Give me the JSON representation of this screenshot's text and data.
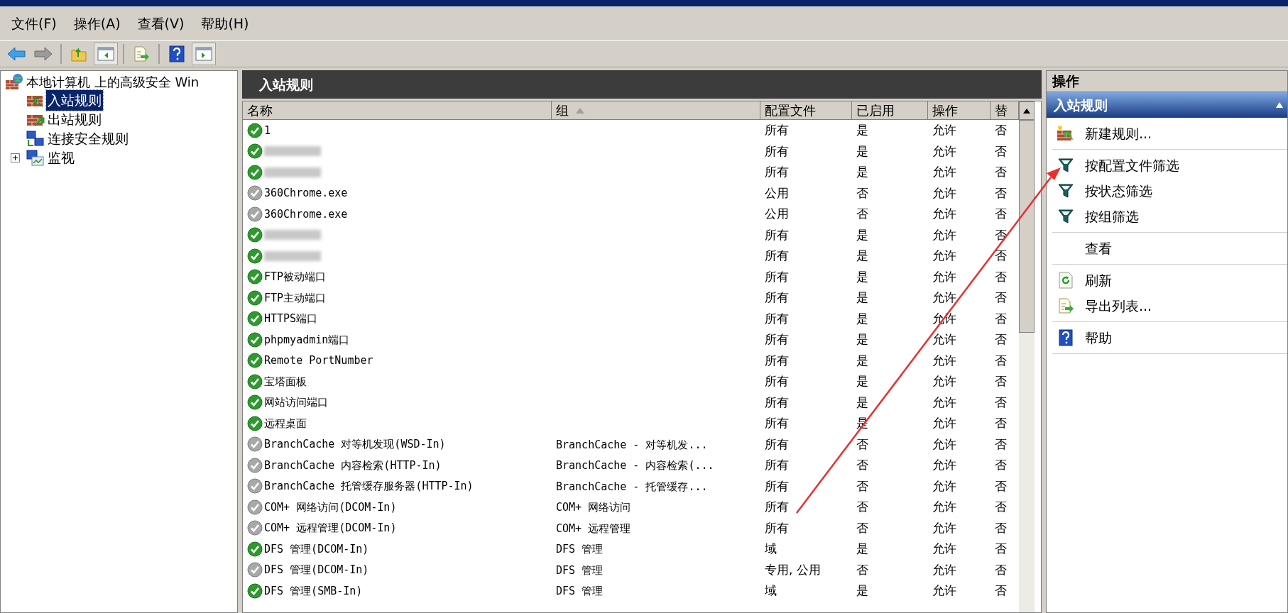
{
  "menu": [
    "文件(F)",
    "操作(A)",
    "查看(V)",
    "帮助(H)"
  ],
  "toolbar": [
    {
      "kind": "back"
    },
    {
      "kind": "forward"
    },
    {
      "kind": "sep"
    },
    {
      "kind": "up"
    },
    {
      "kind": "pane-left",
      "selected": true
    },
    {
      "kind": "sep"
    },
    {
      "kind": "export"
    },
    {
      "kind": "sep"
    },
    {
      "kind": "help"
    },
    {
      "kind": "pane-right",
      "selected": true
    }
  ],
  "tree": {
    "label": "本地计算机 上的高级安全 Win",
    "children": [
      {
        "label": "入站规则",
        "kind": "inbound",
        "selected": true
      },
      {
        "label": "出站规则",
        "kind": "outbound",
        "selected": false
      },
      {
        "label": "连接安全规则",
        "kind": "connection",
        "selected": false
      },
      {
        "label": "监视",
        "kind": "monitor",
        "selected": false,
        "expanded": false
      }
    ]
  },
  "center": {
    "title": "入站规则",
    "columns": [
      {
        "label": "名称"
      },
      {
        "label": "组",
        "sorted": true
      },
      {
        "label": "配置文件"
      },
      {
        "label": "已启用"
      },
      {
        "label": "操作"
      },
      {
        "label": "替"
      }
    ],
    "rows": [
      {
        "enabled": true,
        "name": "1",
        "profile": "所有",
        "enabled_text": "是",
        "action": "允许",
        "override": "否"
      },
      {
        "enabled": true,
        "redacted": true,
        "profile": "所有",
        "enabled_text": "是",
        "action": "允许",
        "override": "否"
      },
      {
        "enabled": true,
        "redacted": true,
        "profile": "所有",
        "enabled_text": "是",
        "action": "允许",
        "override": "否"
      },
      {
        "enabled": false,
        "name": "360Chrome.exe",
        "profile": "公用",
        "enabled_text": "否",
        "action": "允许",
        "override": "否"
      },
      {
        "enabled": false,
        "name": "360Chrome.exe",
        "profile": "公用",
        "enabled_text": "否",
        "action": "允许",
        "override": "否"
      },
      {
        "enabled": true,
        "redacted": true,
        "profile": "所有",
        "enabled_text": "是",
        "action": "允许",
        "override": "否"
      },
      {
        "enabled": true,
        "redacted": true,
        "profile": "所有",
        "enabled_text": "是",
        "action": "允许",
        "override": "否"
      },
      {
        "enabled": true,
        "name": "FTP被动端口",
        "profile": "所有",
        "enabled_text": "是",
        "action": "允许",
        "override": "否"
      },
      {
        "enabled": true,
        "name": "FTP主动端口",
        "profile": "所有",
        "enabled_text": "是",
        "action": "允许",
        "override": "否"
      },
      {
        "enabled": true,
        "name": "HTTPS端口",
        "profile": "所有",
        "enabled_text": "是",
        "action": "允许",
        "override": "否"
      },
      {
        "enabled": true,
        "name": "phpmyadmin端口",
        "profile": "所有",
        "enabled_text": "是",
        "action": "允许",
        "override": "否"
      },
      {
        "enabled": true,
        "name": "Remote PortNumber",
        "profile": "所有",
        "enabled_text": "是",
        "action": "允许",
        "override": "否"
      },
      {
        "enabled": true,
        "name": "宝塔面板",
        "profile": "所有",
        "enabled_text": "是",
        "action": "允许",
        "override": "否"
      },
      {
        "enabled": true,
        "name": "网站访问端口",
        "profile": "所有",
        "enabled_text": "是",
        "action": "允许",
        "override": "否"
      },
      {
        "enabled": true,
        "name": "远程桌面",
        "profile": "所有",
        "enabled_text": "是",
        "action": "允许",
        "override": "否"
      },
      {
        "enabled": false,
        "name": "BranchCache 对等机发现(WSD-In)",
        "group": "BranchCache - 对等机发...",
        "profile": "所有",
        "enabled_text": "否",
        "action": "允许",
        "override": "否"
      },
      {
        "enabled": false,
        "name": "BranchCache 内容检索(HTTP-In)",
        "group": "BranchCache - 内容检索(...",
        "profile": "所有",
        "enabled_text": "否",
        "action": "允许",
        "override": "否"
      },
      {
        "enabled": false,
        "name": "BranchCache 托管缓存服务器(HTTP-In)",
        "group": "BranchCache - 托管缓存...",
        "profile": "所有",
        "enabled_text": "否",
        "action": "允许",
        "override": "否"
      },
      {
        "enabled": false,
        "name": "COM+ 网络访问(DCOM-In)",
        "group": "COM+ 网络访问",
        "profile": "所有",
        "enabled_text": "否",
        "action": "允许",
        "override": "否"
      },
      {
        "enabled": false,
        "name": "COM+ 远程管理(DCOM-In)",
        "group": "COM+ 远程管理",
        "profile": "所有",
        "enabled_text": "否",
        "action": "允许",
        "override": "否"
      },
      {
        "enabled": true,
        "name": "DFS 管理(DCOM-In)",
        "group": "DFS 管理",
        "profile": "域",
        "enabled_text": "是",
        "action": "允许",
        "override": "否"
      },
      {
        "enabled": false,
        "name": "DFS 管理(DCOM-In)",
        "group": "DFS 管理",
        "profile": "专用, 公用",
        "enabled_text": "否",
        "action": "允许",
        "override": "否"
      },
      {
        "enabled": true,
        "name": "DFS 管理(SMB-In)",
        "group": "DFS 管理",
        "profile": "域",
        "enabled_text": "是",
        "action": "允许",
        "override": "否"
      }
    ]
  },
  "actions": {
    "title": "操作",
    "section": {
      "title": "入站规则",
      "expanded": true,
      "groups": [
        [
          {
            "kind": "new-rule",
            "label": "新建规则..."
          }
        ],
        [
          {
            "kind": "filter",
            "label": "按配置文件筛选"
          },
          {
            "kind": "filter",
            "label": "按状态筛选"
          },
          {
            "kind": "filter",
            "label": "按组筛选"
          }
        ],
        [
          {
            "kind": "none",
            "label": "查看"
          }
        ],
        [
          {
            "kind": "refresh",
            "label": "刷新"
          },
          {
            "kind": "export",
            "label": "导出列表..."
          }
        ],
        [
          {
            "kind": "help",
            "label": "帮助"
          }
        ]
      ]
    }
  },
  "annotation": {
    "kind": "arrow"
  }
}
